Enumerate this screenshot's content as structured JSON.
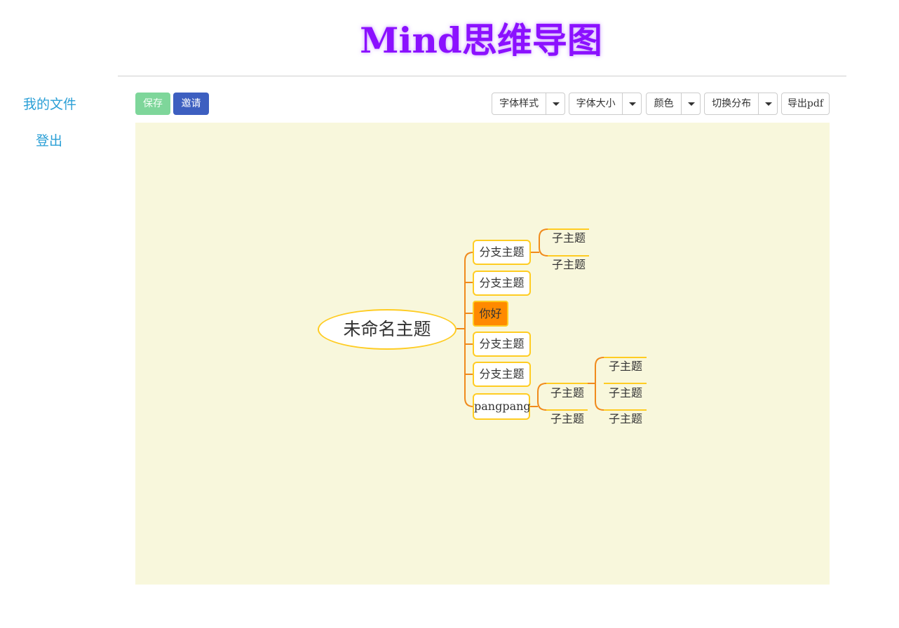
{
  "header": {
    "title": "Mind思维导图"
  },
  "sidebar": {
    "items": [
      {
        "label": "我的文件"
      },
      {
        "label": "登出"
      }
    ]
  },
  "toolbar": {
    "save_label": "保存",
    "invite_label": "邀请",
    "dropdowns": [
      {
        "label": "字体样式"
      },
      {
        "label": "字体大小"
      },
      {
        "label": "颜色"
      },
      {
        "label": "切换分布"
      }
    ],
    "export_label": "导出pdf"
  },
  "mindmap": {
    "root": "未命名主题",
    "branches": [
      {
        "label": "分支主题",
        "children": [
          "子主题",
          "子主题"
        ]
      },
      {
        "label": "分支主题"
      },
      {
        "label": "你好",
        "selected": true
      },
      {
        "label": "分支主题"
      },
      {
        "label": "分支主题"
      },
      {
        "label": "pangpang",
        "children": [
          "子主题",
          "子主题"
        ],
        "grandchildren": [
          "子主题",
          "子主题",
          "子主题"
        ]
      }
    ]
  },
  "colors": {
    "accent": "#8b10ff",
    "link": "#2a9fd6",
    "save": "#7ed69a",
    "invite": "#3d5fc0",
    "canvas": "#f8f7dc",
    "node_border": "#ffcc22",
    "connector": "#f08a1c",
    "selected": "#ff8a00"
  }
}
